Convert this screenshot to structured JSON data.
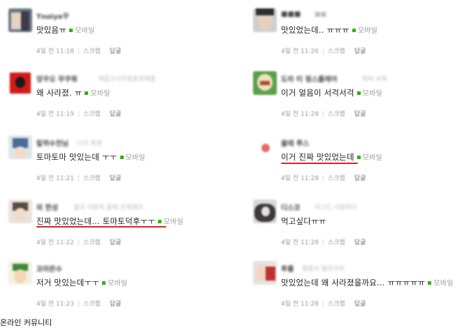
{
  "left": [
    {
      "nick": "Tnoiye꾸",
      "nick_sub": "",
      "text": "맛있음ㅠ",
      "time": "4일 전 11:18",
      "scrap": "스크랩",
      "reply": "답글",
      "mobile": "모바일"
    },
    {
      "nick": "앙꾸오 무쿠뭐",
      "nick_sub": "개엽고너무잘표현해용",
      "text": "왜 사라졌. ㅠ",
      "time": "4일 전 11:19",
      "scrap": "스크랩",
      "reply": "답글",
      "mobile": "모바일"
    },
    {
      "nick": "칼퀴수천님",
      "nick_sub": "나의 회영",
      "text": "토마토마 맛있는데 ㅜㅜ",
      "time": "4일 전 11:21",
      "scrap": "스크랩",
      "reply": "답글",
      "mobile": "모바일"
    },
    {
      "nick": "외 한성",
      "nick_sub": "결국 사랑의 끝에 선게제이",
      "text": "진짜 맛있었는데... 토마토덕후ㅜㅜ",
      "time": "4일 전 11:22",
      "scrap": "스크랩",
      "reply": "답글",
      "mobile": "모바일"
    },
    {
      "nick": "꼬마믄수",
      "nick_sub": "",
      "text": "저거 맛있는데ㅜㅜ",
      "time": "4일 전 11:23",
      "scrap": "스크랩",
      "reply": "답글",
      "mobile": "모바일"
    }
  ],
  "right": [
    {
      "nick": "■■■",
      "nick_sub": "■■",
      "text": "맛있었는데.. ㅠㅠㅠ",
      "time": "4일 전 11:26",
      "scrap": "스크랩",
      "reply": "답글",
      "mobile": "모바일"
    },
    {
      "nick": "도라 티 핑스플레어",
      "nick_sub": "뭐하 씨파",
      "text": "이거 얼음이 서걱서걱",
      "time": "4일 전 11:28",
      "scrap": "스크랩",
      "reply": "답글",
      "mobile": "모바일"
    },
    {
      "nick": "클레 루스",
      "nick_sub": "",
      "text": "이거 진짜 맛있었는데",
      "time": "4일 전 11:28",
      "scrap": "스크랩",
      "reply": "답글",
      "mobile": "모바일"
    },
    {
      "nick": "디스코",
      "nick_sub": "이그드 사랑하다",
      "text": "먹고싶다ㅠㅠ",
      "time": "4일 전 11:28",
      "scrap": "스크랩",
      "reply": "답글",
      "mobile": ""
    },
    {
      "nick": "루룸",
      "nick_sub": "평동이 빌려가부",
      "text": "맛있었는데 왜 사라졌을까요... ㅠㅠㅠㅠㅠ",
      "time": "4일 전 11:28",
      "scrap": "스크랩",
      "reply": "답글",
      "mobile": "모바일"
    }
  ],
  "caption": "온라인 커뮤니티",
  "colors": {
    "mobile_dot": "#2db400",
    "underline": "#e02020"
  }
}
